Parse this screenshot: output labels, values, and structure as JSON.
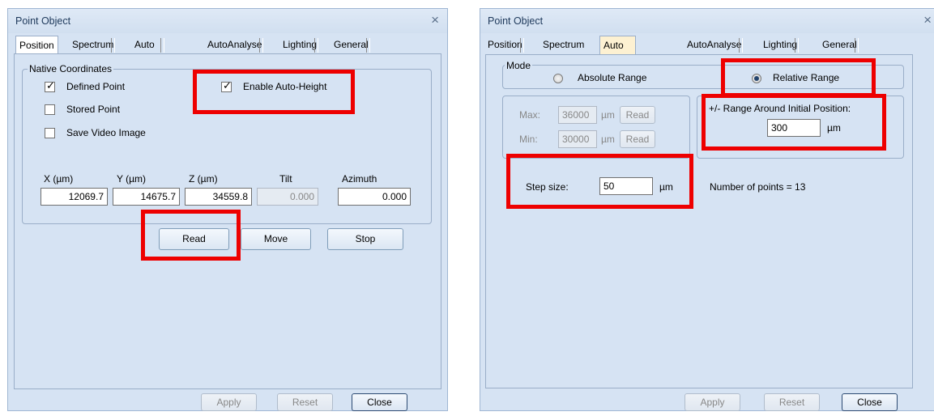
{
  "left_dialog": {
    "title": "Point Object",
    "close": "×",
    "tabs": [
      "Position",
      "Spectrum",
      "Auto Height",
      "AutoAnalyse",
      "Lighting",
      "General"
    ],
    "group_title": "Native Coordinates",
    "checkboxes": {
      "defined_point": "Defined Point",
      "stored_point": "Stored Point",
      "save_video": "Save Video Image",
      "enable_auto_height": "Enable Auto-Height"
    },
    "check_mark": "✓",
    "coord_labels": {
      "x": "X (µm)",
      "y": "Y (µm)",
      "z": "Z (µm)",
      "tilt": "Tilt",
      "azimuth": "Azimuth"
    },
    "coord_values": {
      "x": "12069.7",
      "y": "14675.7",
      "z": "34559.8",
      "tilt": "0.000",
      "azimuth": "0.000"
    },
    "buttons": {
      "read": "Read",
      "move": "Move",
      "stop": "Stop"
    },
    "footer": {
      "apply": "Apply",
      "reset": "Reset",
      "close": "Close"
    }
  },
  "right_dialog": {
    "title": "Point Object",
    "close": "×",
    "tabs": [
      "Position",
      "Spectrum",
      "Auto Height",
      "AutoAnalyse",
      "Lighting",
      "General"
    ],
    "mode_title": "Mode",
    "absolute_range": "Absolute Range",
    "relative_range": "Relative Range",
    "max_label": "Max:",
    "max_value": "36000",
    "min_label": "Min:",
    "min_value": "30000",
    "um_unit": "µm",
    "read_label": "Read",
    "range_label": "+/- Range Around Initial Position:",
    "range_value": "300",
    "step_label": "Step size:",
    "step_value": "50",
    "points_text": "Number of points = 13",
    "footer": {
      "apply": "Apply",
      "reset": "Reset",
      "close": "Close"
    }
  },
  "highlight_color": "#ee0000"
}
